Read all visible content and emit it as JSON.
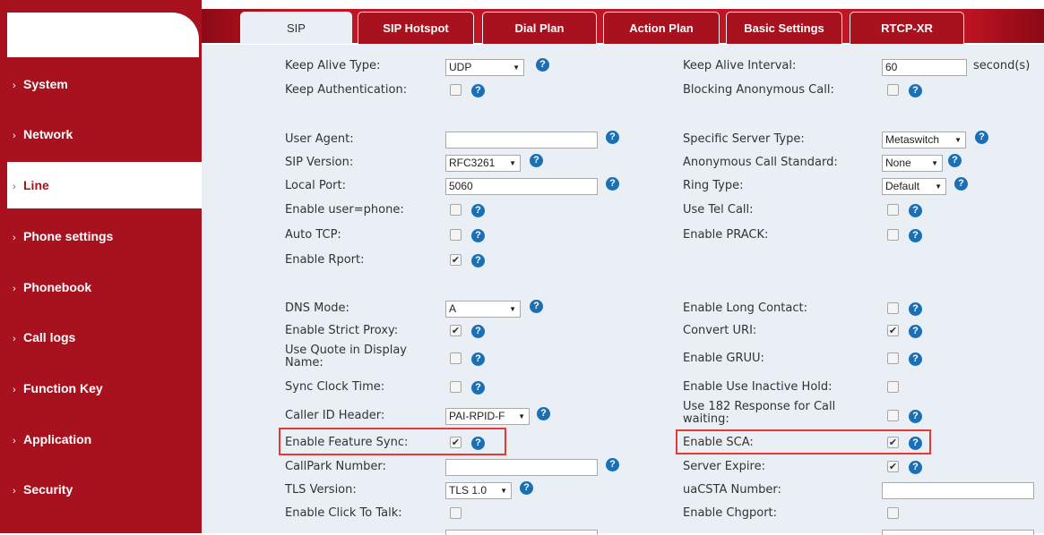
{
  "sidebar": {
    "items": [
      {
        "label": "System"
      },
      {
        "label": "Network"
      },
      {
        "label": "Line"
      },
      {
        "label": "Phone settings"
      },
      {
        "label": "Phonebook"
      },
      {
        "label": "Call logs"
      },
      {
        "label": "Function Key"
      },
      {
        "label": "Application"
      },
      {
        "label": "Security"
      }
    ],
    "active": "Line"
  },
  "tabs": [
    {
      "label": "SIP"
    },
    {
      "label": "SIP Hotspot"
    },
    {
      "label": "Dial Plan"
    },
    {
      "label": "Action Plan"
    },
    {
      "label": "Basic Settings"
    },
    {
      "label": "RTCP-XR"
    }
  ],
  "active_tab": "SIP",
  "form": {
    "keep_alive_type": {
      "label": "Keep Alive Type:",
      "value": "UDP"
    },
    "keep_alive_interval": {
      "label": "Keep Alive Interval:",
      "value": "60",
      "unit": "second(s)"
    },
    "keep_authentication": {
      "label": "Keep Authentication:",
      "checked": false
    },
    "blocking_anonymous_call": {
      "label": "Blocking Anonymous Call:",
      "checked": false
    },
    "user_agent": {
      "label": "User Agent:",
      "value": ""
    },
    "specific_server_type": {
      "label": "Specific Server Type:",
      "value": "Metaswitch"
    },
    "sip_version": {
      "label": "SIP Version:",
      "value": "RFC3261"
    },
    "anonymous_call_standard": {
      "label": "Anonymous Call Standard:",
      "value": "None"
    },
    "local_port": {
      "label": "Local Port:",
      "value": "5060"
    },
    "ring_type": {
      "label": "Ring Type:",
      "value": "Default"
    },
    "enable_user_phone": {
      "label": "Enable user=phone:",
      "checked": false
    },
    "use_tel_call": {
      "label": "Use Tel Call:",
      "checked": false
    },
    "auto_tcp": {
      "label": "Auto TCP:",
      "checked": false
    },
    "enable_prack": {
      "label": "Enable PRACK:",
      "checked": false
    },
    "enable_rport": {
      "label": "Enable Rport:",
      "checked": true
    },
    "dns_mode": {
      "label": "DNS Mode:",
      "value": "A"
    },
    "enable_long_contact": {
      "label": "Enable Long Contact:",
      "checked": false
    },
    "enable_strict_proxy": {
      "label": "Enable Strict Proxy:",
      "checked": true
    },
    "convert_uri": {
      "label": "Convert URI:",
      "checked": true
    },
    "use_quote_in_display_name": {
      "label": "Use Quote in Display Name:",
      "checked": false
    },
    "enable_gruu": {
      "label": "Enable GRUU:",
      "checked": false
    },
    "sync_clock_time": {
      "label": "Sync Clock Time:",
      "checked": false
    },
    "enable_use_inactive_hold": {
      "label": "Enable Use Inactive Hold:",
      "checked": false
    },
    "caller_id_header": {
      "label": "Caller ID Header:",
      "value": "PAI-RPID-F"
    },
    "use_182_response": {
      "label": "Use 182 Response for Call waiting:",
      "checked": false
    },
    "enable_feature_sync": {
      "label": "Enable Feature Sync:",
      "checked": true
    },
    "enable_sca": {
      "label": "Enable SCA:",
      "checked": true
    },
    "callpark_number": {
      "label": "CallPark Number:",
      "value": ""
    },
    "server_expire": {
      "label": "Server Expire:",
      "checked": true
    },
    "tls_version": {
      "label": "TLS Version:",
      "value": "TLS 1.0"
    },
    "uacsta_number": {
      "label": "uaCSTA Number:",
      "value": ""
    },
    "enable_click_to_talk": {
      "label": "Enable Click To Talk:",
      "checked": false
    },
    "enable_chgport": {
      "label": "Enable Chgport:",
      "checked": false
    }
  },
  "icons": {
    "help": "?",
    "checkmark": "✔",
    "dropdown_arrow": "▼",
    "chevron": "›"
  },
  "colors": {
    "brand": "#a8111e",
    "content_bg": "#e9eff5",
    "help_icon": "#1c6fb3",
    "highlight": "#e53935"
  }
}
